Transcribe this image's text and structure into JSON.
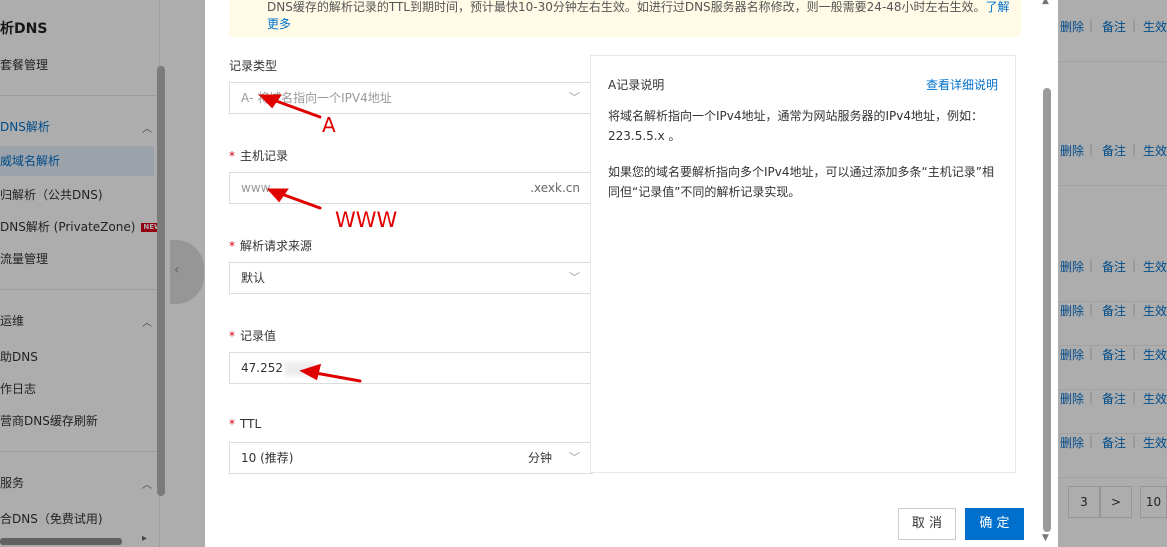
{
  "sidebar": {
    "title": "析DNS",
    "items": [
      {
        "label": "套餐管理"
      },
      {
        "label": "DNS解析"
      },
      {
        "label": "威域名解析"
      },
      {
        "label": "归解析（公共DNS)"
      },
      {
        "label": "DNS解析 (PrivateZone)",
        "badge": "NEW"
      },
      {
        "label": "流量管理"
      },
      {
        "label": "运维"
      },
      {
        "label": "助DNS"
      },
      {
        "label": "作日志"
      },
      {
        "label": "营商DNS缓存刷新"
      },
      {
        "label": "服务"
      },
      {
        "label": "合DNS（免费试用)"
      }
    ]
  },
  "table": {
    "row_actions": {
      "delete": "删除",
      "remark": "备注",
      "effective": "生效"
    },
    "rows": 8
  },
  "pager": {
    "page": "3",
    "next": ">",
    "size": "10"
  },
  "modal": {
    "notice_text": "DNS缓存的解析记录的TTL到期时间，预计最快10-30分钟左右生效。如进行过DNS服务器名称修改，则一般需要24-48小时左右生效。",
    "notice_link_a": "了解",
    "notice_link_b": "更多",
    "record_type": {
      "label": "记录类型",
      "placeholder": "A- 将域名指向一个IPV4地址"
    },
    "host": {
      "label": "主机记录",
      "value": "www",
      "suffix": ".xexk.cn"
    },
    "source": {
      "label": "解析请求来源",
      "value": "默认"
    },
    "record_value": {
      "label": "记录值",
      "value": "47.252"
    },
    "ttl": {
      "label": "TTL",
      "value": "10 (推荐)",
      "unit": "分钟"
    },
    "help": {
      "title": "A记录说明",
      "link": "查看详细说明",
      "p1": "将域名解析指向一个IPv4地址，通常为网站服务器的IPv4地址，例如：223.5.5.x 。",
      "p2": "如果您的域名要解析指向多个IPv4地址，可以通过添加多条“主机记录”相同但“记录值”不同的解析记录实现。"
    },
    "cancel_label": "取 消",
    "ok_label": "确 定"
  },
  "annotations": {
    "a_label": "A",
    "www_label": "WWW",
    "color": "#e00000"
  },
  "colors": {
    "accent": "#0070cc",
    "required": "#d9001b",
    "notice_bg": "#fffbe6"
  }
}
